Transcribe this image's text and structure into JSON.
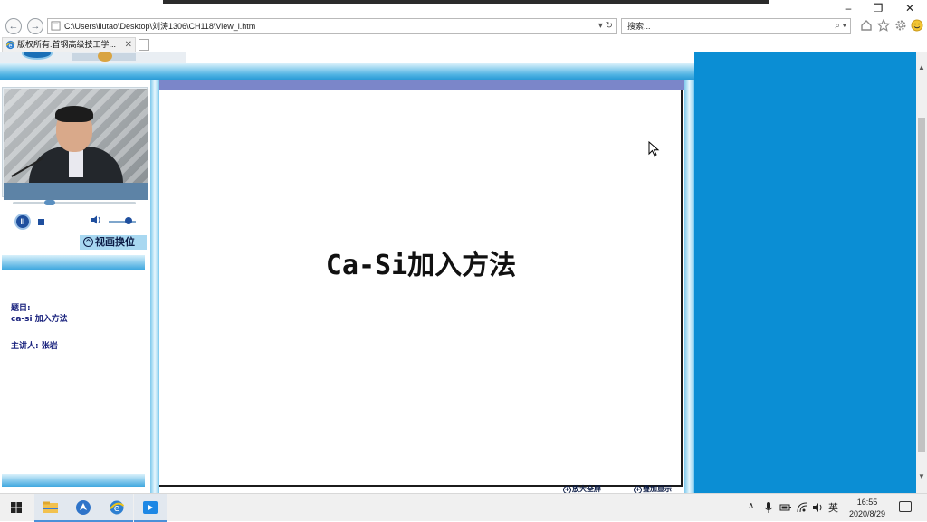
{
  "window": {
    "minimize": "–",
    "restore": "❐",
    "close": "✕"
  },
  "toolbar": {
    "back": "←",
    "forward": "→",
    "address": "C:\\Users\\liutao\\Desktop\\刘涛1306\\CH118\\View_l.htm",
    "address_tail": "▾ ↻",
    "search_placeholder": "搜索...",
    "search_tail": "⌕ ▾",
    "icons": [
      "home-icon",
      "star-icon",
      "gear-icon",
      "smiley-icon"
    ]
  },
  "tab": {
    "title": "版权所有:首钢高级技工学...",
    "close": "✕"
  },
  "player": {
    "pause": "II",
    "volume_level": 0.6,
    "seek_position": 0.3,
    "swap_label": "视画换位",
    "swap_glyph": "^"
  },
  "info": {
    "title_label": "题目:",
    "title_value": "ca-si 加入方法",
    "speaker": "主讲人: 张岩"
  },
  "slide": {
    "title": "Ca-Si加入方法"
  },
  "bottom_buttons": {
    "enlarge": "放大全屏",
    "add": "叠加显示"
  },
  "taskbar": {
    "apps": [
      "start",
      "file-explorer",
      "app-blue",
      "internet-explorer",
      "media-app"
    ],
    "ime": "英",
    "time": "16:55",
    "date": "2020/8/29"
  },
  "colors": {
    "accent_blue": "#0b8ed4",
    "slide_bar": "#7b86c9",
    "info_text": "#1a237e"
  }
}
